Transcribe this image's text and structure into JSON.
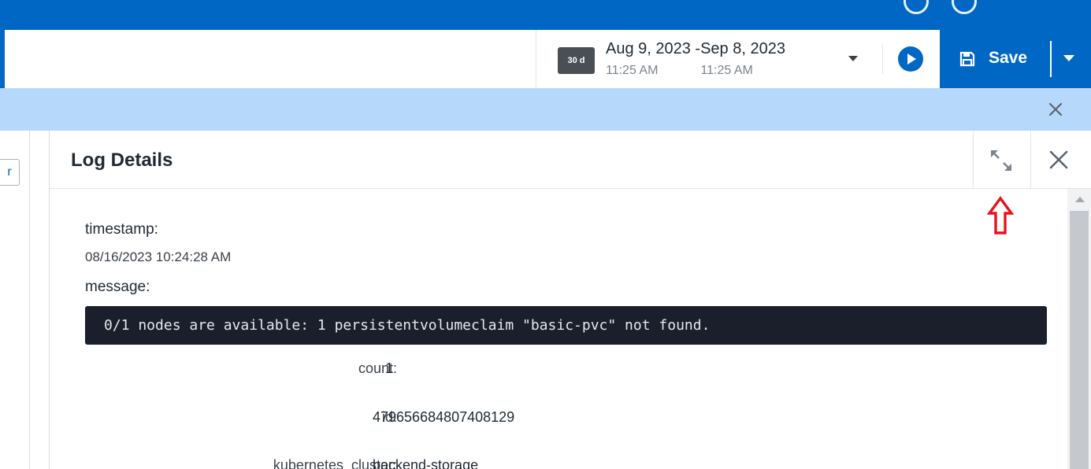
{
  "toolbar": {
    "range_badge": "30 d",
    "date_range": "Aug 9, 2023 -Sep 8, 2023",
    "start_time": "11:25 AM",
    "end_time": "11:25 AM",
    "save_label": "Save"
  },
  "details": {
    "title": "Log Details",
    "left_stub_text": "r",
    "fields": {
      "timestamp_label": "timestamp:",
      "timestamp_value": "08/16/2023 10:24:28 AM",
      "message_label": "message:",
      "message_value": "0/1 nodes are available: 1 persistentvolumeclaim \"basic-pvc\" not found."
    },
    "rows": [
      {
        "key": "count:",
        "value": "1"
      },
      {
        "key": "id:",
        "value": "479656684807408129"
      },
      {
        "key": "kubernetes_cluster:",
        "value": "backend-storage"
      }
    ]
  },
  "icons": {
    "save": "floppy-disk-icon",
    "play": "play-icon",
    "expand": "expand-icon",
    "close": "close-icon",
    "annotation": "red-up-arrow-icon"
  },
  "colors": {
    "brand_blue": "#0067c5",
    "banner_blue": "#b6d8fa",
    "message_bg": "#1a1f2b",
    "annotation_red": "#e8121b"
  }
}
